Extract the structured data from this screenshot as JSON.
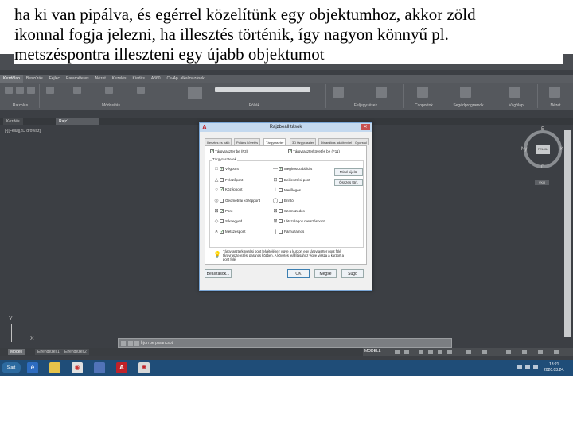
{
  "caption": {
    "line1": "ha ki van pipálva, és egérrel közelítünk egy objektumhoz, akkor zöld",
    "line2": "ikonnal fogja jelezni, ha illesztés történik, így nagyon könnyű pl.",
    "line3": "metszéspontra illeszteni egy újabb objektumot"
  },
  "ribbon": {
    "tabs": [
      "Kezdőlap",
      "Beszúrás",
      "Fejléc",
      "Paraméteres",
      "Nézet",
      "Kezelés",
      "Kiadás",
      "A360",
      "Ce-Ap. alkalmazások"
    ],
    "groups": [
      {
        "label": "Rajzolás"
      },
      {
        "label": "Módosítás"
      },
      {
        "label": "Fóliák"
      },
      {
        "label": "Feljegyzések"
      },
      {
        "label": "Csoportok"
      },
      {
        "label": "Segédprogramok"
      },
      {
        "label": "Vágólap"
      },
      {
        "label": "Nézet"
      }
    ]
  },
  "doc_tabs": [
    "Kezdés",
    "Rajz1"
  ],
  "viewport_label": "[-][Felül][2D drótváz]",
  "navcube": {
    "face": "FELÜL",
    "north": "É",
    "south": "D",
    "west": "Ny",
    "east": "K",
    "wcs": "VKR"
  },
  "ucs": {
    "x": "X",
    "y": "Y"
  },
  "command": {
    "prompt": "Írjon be parancsot"
  },
  "layout_tabs": [
    "Modell",
    "Elrendezés1",
    "Elrendezés2"
  ],
  "status": {
    "model": "MODELL"
  },
  "taskbar": {
    "start": "Start",
    "time": "13:21",
    "date": "2020.03.24."
  },
  "dialog": {
    "title": "Rajzbeállítások",
    "close": "✕",
    "tabs": [
      "Illesztés és háló",
      "Poláris követés",
      "Tárgyraszter",
      "3D tárgyraszter",
      "Dinamikus adatbevitel",
      "Gyorstul"
    ],
    "active_tab": 2,
    "osnap_on": "Tárgyraszter be (F3)",
    "osnap_track": "Tárgyraszterkövetés be (F11)",
    "group_title": "Tárgyraszterek",
    "left_modes": [
      {
        "glyph": "□",
        "label": "Végpont",
        "checked": true
      },
      {
        "glyph": "△",
        "label": "Felezőpont",
        "checked": false
      },
      {
        "glyph": "○",
        "label": "Középpont",
        "checked": true
      },
      {
        "glyph": "◎",
        "label": "Geometriai középpont",
        "checked": false
      },
      {
        "glyph": "⊠",
        "label": "Pont",
        "checked": true
      },
      {
        "glyph": "◇",
        "label": "Síknegyed",
        "checked": false
      },
      {
        "glyph": "✕",
        "label": "Metszéspont",
        "checked": true
      }
    ],
    "right_modes": [
      {
        "glyph": "—",
        "label": "Meghosszabbítás",
        "checked": true
      },
      {
        "glyph": "⊡",
        "label": "Beillesztési pont",
        "checked": false
      },
      {
        "glyph": "⊥",
        "label": "Merőleges",
        "checked": false
      },
      {
        "glyph": "◯",
        "label": "Érintő",
        "checked": false
      },
      {
        "glyph": "⊠",
        "label": "Szomszédos",
        "checked": false
      },
      {
        "glyph": "⊠",
        "label": "Látszólagos metszéspont",
        "checked": false
      },
      {
        "glyph": "∥",
        "label": "Párhuzamos",
        "checked": false
      }
    ],
    "select_all": "Mind kijelöl",
    "clear_all": "Összes törl.",
    "info": "Tárgyraszterkövetési pont felvételéhez vigye a kurzort egy tárgyraszter pont fölé tárgyraszterezési parancs közben. A követés leállításához vigye vissza a kurzort a pont fölé.",
    "options_btn": "Beállítások...",
    "ok": "OK",
    "cancel": "Mégse",
    "help": "Súgó"
  }
}
